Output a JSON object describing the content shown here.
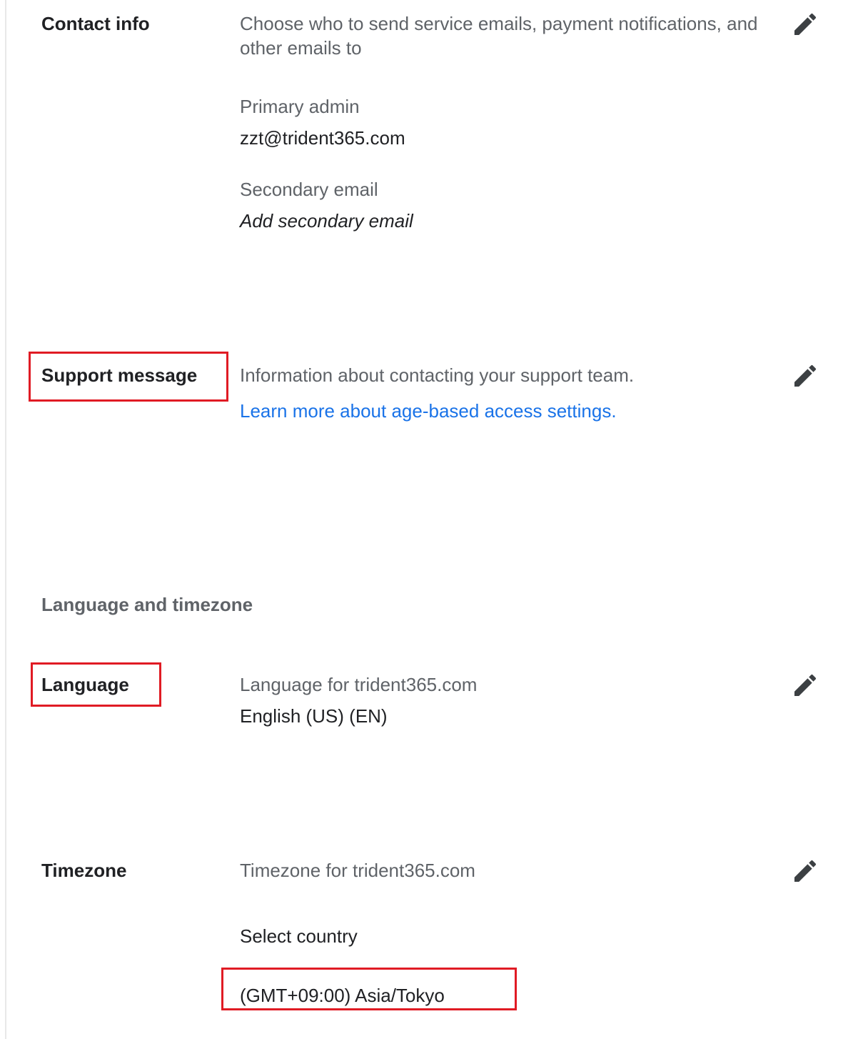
{
  "contact_info": {
    "label": "Contact info",
    "description_line1": "Choose who to send service emails, payment notifications, and",
    "description_line2": "other emails to",
    "primary_admin_label": "Primary admin",
    "primary_admin_value": "zzt@trident365.com",
    "secondary_email_label": "Secondary email",
    "secondary_email_action": "Add secondary email"
  },
  "support_message": {
    "label": "Support message",
    "description": "Information about contacting your support team.",
    "link_text": "Learn more about age-based access settings."
  },
  "language_timezone": {
    "section_title": "Language and timezone",
    "language": {
      "label": "Language",
      "description": "Language for trident365.com",
      "value": "English (US) (EN)"
    },
    "timezone": {
      "label": "Timezone",
      "description": "Timezone for trident365.com",
      "select_country_label": "Select country",
      "value": "(GMT+09:00) Asia/Tokyo"
    }
  },
  "icons": {
    "edit": "pencil-edit-icon"
  },
  "colors": {
    "highlight": "#e01b24",
    "link": "#1a73e8",
    "secondary_text": "#5f6368",
    "primary_text": "#202124",
    "icon": "#3c4043"
  }
}
